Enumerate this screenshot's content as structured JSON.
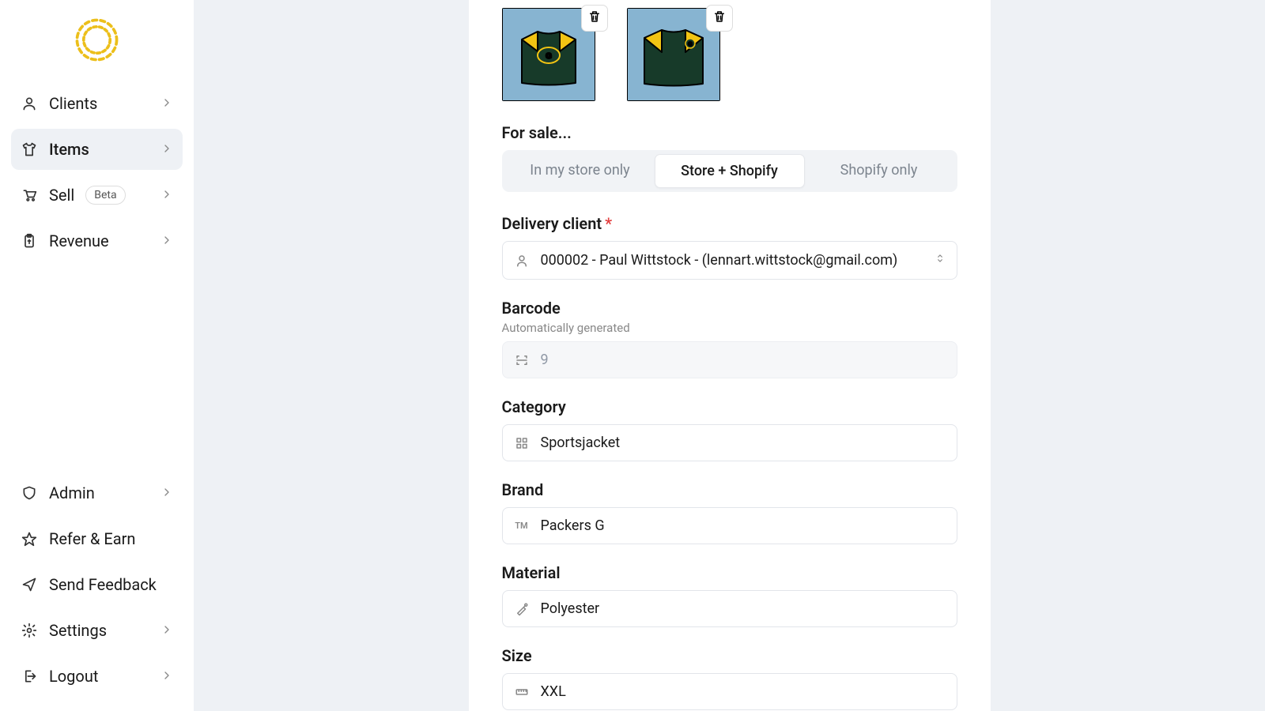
{
  "logo": {
    "alt": "Circle Hand"
  },
  "sidebar": {
    "top": [
      {
        "label": "Clients",
        "active": false,
        "chev": true
      },
      {
        "label": "Items",
        "active": true,
        "chev": true
      },
      {
        "label": "Sell",
        "badge": "Beta",
        "active": false,
        "chev": true
      },
      {
        "label": "Revenue",
        "active": false,
        "chev": true
      }
    ],
    "bottom": [
      {
        "label": "Admin",
        "chev": true
      },
      {
        "label": "Refer & Earn",
        "chev": false
      },
      {
        "label": "Send Feedback",
        "chev": false
      },
      {
        "label": "Settings",
        "chev": true
      },
      {
        "label": "Logout",
        "chev": true
      }
    ]
  },
  "form": {
    "for_sale_label": "For sale...",
    "sale_channels": [
      {
        "label": "In my store only",
        "active": false
      },
      {
        "label": "Store + Shopify",
        "active": true
      },
      {
        "label": "Shopify only",
        "active": false
      }
    ],
    "delivery_client_label": "Delivery client",
    "delivery_client_value": "000002 - Paul Wittstock - (lennart.wittstock@gmail.com)",
    "barcode_label": "Barcode",
    "barcode_sublabel": "Automatically generated",
    "barcode_value": "9",
    "category_label": "Category",
    "category_value": "Sportsjacket",
    "brand_label": "Brand",
    "brand_value": "Packers G",
    "material_label": "Material",
    "material_value": "Polyester",
    "size_label": "Size",
    "size_value": "XXL"
  }
}
